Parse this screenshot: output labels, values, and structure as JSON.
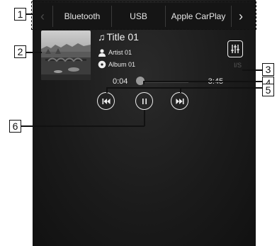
{
  "tabs": {
    "items": [
      {
        "label": "Bluetooth"
      },
      {
        "label": "USB"
      },
      {
        "label": "Apple CarPlay"
      }
    ],
    "prev_icon": "chevron-left-icon",
    "next_icon": "chevron-right-icon"
  },
  "now_playing": {
    "title": "Title 01",
    "artist": "Artist 01",
    "album": "Album 01",
    "elapsed": "0:04",
    "remaining": "-3:45",
    "progress_fraction": 0.02,
    "cut_off_text": "I/S"
  },
  "controls": {
    "prev_icon": "skip-previous-icon",
    "pause_icon": "pause-icon",
    "next_icon": "skip-next-icon",
    "sound_settings_icon": "equalizer-icon"
  },
  "callouts": [
    "1",
    "2",
    "3",
    "4",
    "5",
    "6"
  ]
}
